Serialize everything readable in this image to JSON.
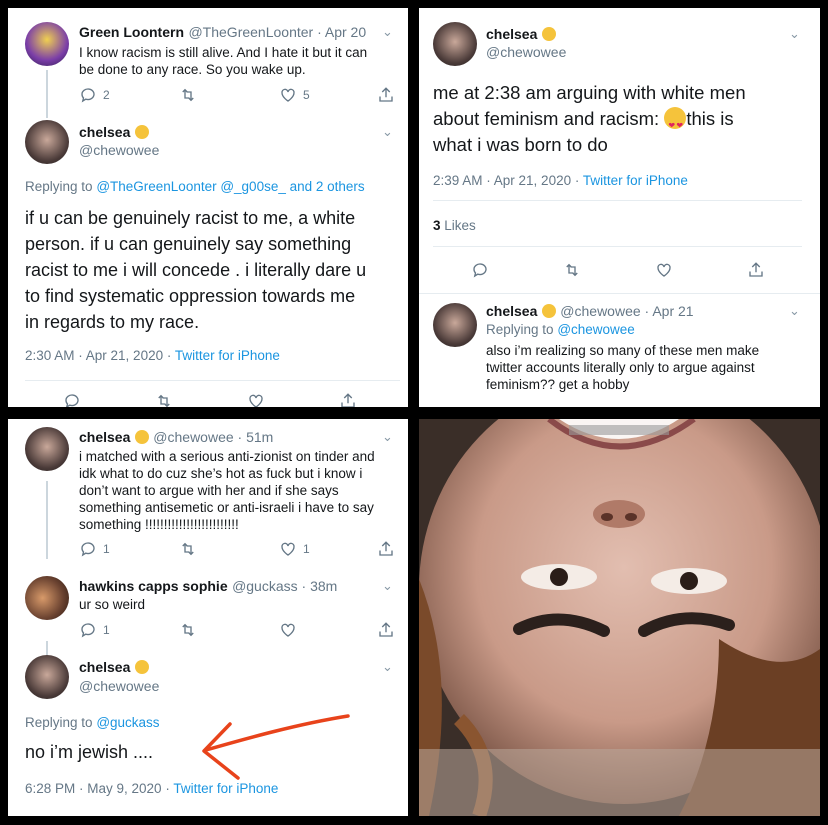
{
  "panel1": {
    "tweet1": {
      "name": "Green Loontern",
      "handle": "@TheGreenLoonter · Apr 20",
      "text_lines": [
        "I know racism is still alive. And I hate it but it can",
        "be done to any race. So you wake up."
      ],
      "reply_count": "2",
      "like_count": "5"
    },
    "tweet2": {
      "name": "chelsea",
      "handle": "@chewowee",
      "replying_prefix": "Replying to",
      "replying_to": "@TheGreenLoonter @_g00se_ and 2 others",
      "text_lines": [
        "if u can be genuinely  racist to me, a white",
        "person. if u can genuinely say something",
        "racist to me i will concede . i literally dare u",
        "to find systematic oppression towards me",
        "in regards to my race."
      ],
      "timestamp": "2:30 AM · Apr 21, 2020 · ",
      "source": "Twitter for iPhone"
    }
  },
  "panel2": {
    "tweet1": {
      "name": "chelsea",
      "handle": "@chewowee",
      "text_lines": [
        "me at 2:38 am arguing with white men",
        "about feminism and racism:",
        "this is",
        "what i was born to do"
      ],
      "timestamp": "2:39 AM · Apr 21, 2020 · ",
      "source": "Twitter for iPhone",
      "likes_count": "3",
      "likes_label": "Likes"
    },
    "tweet2": {
      "name": "chelsea",
      "handle": "@chewowee · Apr 21",
      "replying_prefix": "Replying to",
      "replying_to": "@chewowee",
      "text_lines": [
        "also i’m realizing so many of these men make",
        "twitter accounts literally only to argue against",
        "feminism?? get a hobby"
      ]
    }
  },
  "panel3": {
    "tweet1": {
      "name": "chelsea",
      "handle": "@chewowee · 51m",
      "text_lines": [
        "i matched with a serious anti-zionist on tinder and",
        "idk what to do cuz she’s hot as fuck but i know i",
        "don’t want to argue with her and if she says",
        "something antisemetic or anti-israeli i have to say",
        "something !!!!!!!!!!!!!!!!!!!!!!!!!"
      ],
      "reply_count": "1",
      "like_count": "1"
    },
    "tweet2": {
      "name": "hawkins capps sophie",
      "handle": "@guckass · 38m",
      "text": "ur so weird",
      "reply_count": "1"
    },
    "tweet3": {
      "name": "chelsea",
      "handle": "@chewowee",
      "replying_prefix": "Replying to",
      "replying_to": "@guckass",
      "text": "no i’m jewish ....",
      "timestamp": "6:28 PM · May 9, 2020 · ",
      "source": "Twitter for iPhone"
    }
  },
  "colors": {
    "link": "#1b95e0",
    "muted": "#657786",
    "annotation_arrow": "#e8431b"
  }
}
